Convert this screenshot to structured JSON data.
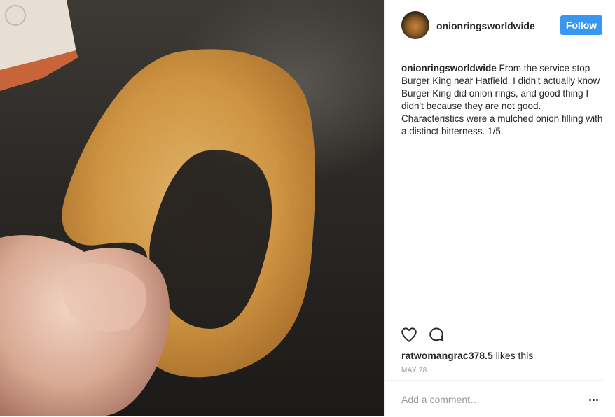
{
  "post": {
    "photo_alt": "",
    "author": {
      "username": "onionringsworldwide"
    },
    "follow_label": "Follow",
    "caption": {
      "username": "onionringsworldwide",
      "text": "From the service stop Burger King near Hatfield. I didn't actually know Burger King did onion rings, and good thing I didn't because they are not good. Characteristics were a mulched onion filling with a distinct bitterness. 1/5."
    },
    "actions": {
      "like_icon": "heart-icon",
      "comment_icon": "speech-bubble-icon"
    },
    "likes": {
      "liker": "ratwomangrac378.5",
      "suffix": "likes this"
    },
    "date": "MAY 28",
    "comment": {
      "placeholder": "Add a comment…",
      "more_icon": "more-options-icon"
    }
  },
  "colors": {
    "follow_button": "#3897f0",
    "text": "#262626",
    "muted": "#999999",
    "divider": "#efefef"
  }
}
